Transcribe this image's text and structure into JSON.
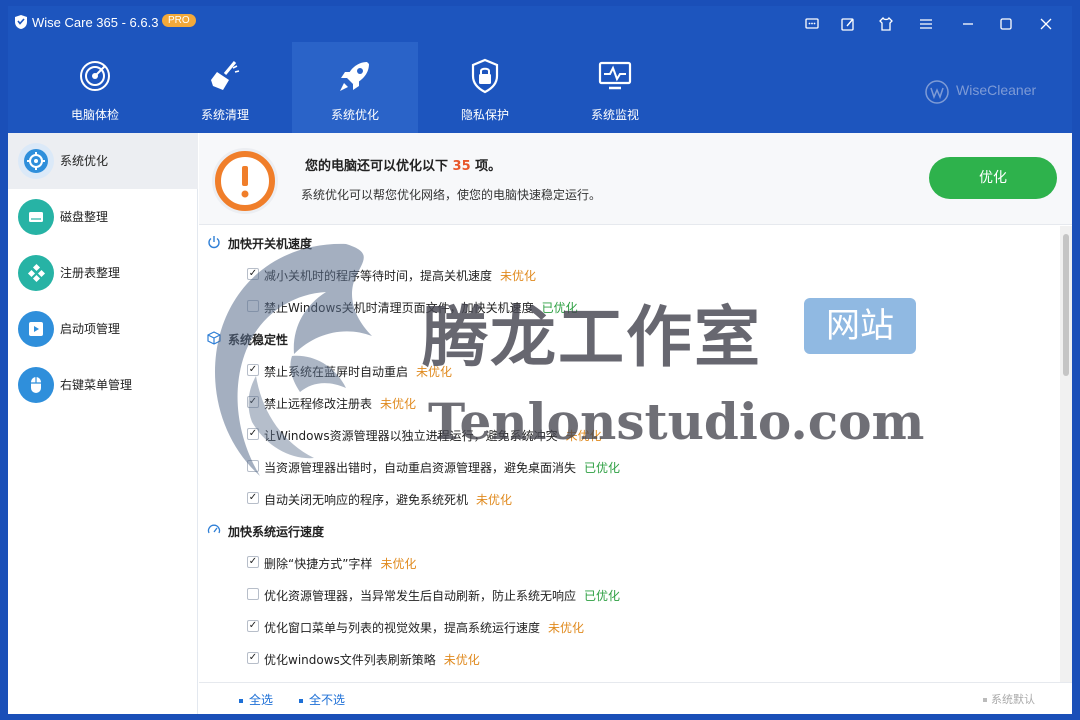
{
  "window": {
    "app_title": "Wise Care 365 - 6.6.3",
    "badge": "PRO",
    "toolbar_icons": [
      "chat-icon",
      "edit-icon",
      "tshirt-icon",
      "menu-icon",
      "minimize-icon",
      "maximize-icon",
      "close-icon"
    ]
  },
  "nav": {
    "items": [
      {
        "label": "电脑体检",
        "icon": "radar-icon"
      },
      {
        "label": "系统清理",
        "icon": "broom-icon"
      },
      {
        "label": "系统优化",
        "icon": "rocket-icon"
      },
      {
        "label": "隐私保护",
        "icon": "lock-icon"
      },
      {
        "label": "系统监视",
        "icon": "monitor-pulse-icon"
      }
    ],
    "active": "系统优化",
    "brand": "WiseCleaner"
  },
  "sidebar": {
    "items": [
      {
        "label": "系统优化",
        "icon": "gear-icon",
        "color": "#2f8fdb"
      },
      {
        "label": "磁盘整理",
        "icon": "disk-icon",
        "color": "#27b3a5"
      },
      {
        "label": "注册表整理",
        "icon": "registry-icon",
        "color": "#27b3a5"
      },
      {
        "label": "启动项管理",
        "icon": "play-icon",
        "color": "#2f8fdb"
      },
      {
        "label": "右键菜单管理",
        "icon": "mouse-icon",
        "color": "#2f8fdb"
      }
    ],
    "active": "系统优化"
  },
  "header": {
    "title_prefix": "您的电脑还可以优化以下",
    "count": "35",
    "title_suffix": "项。",
    "desc": "系统优化可以帮您优化网络，使您的电脑快速稳定运行。",
    "button": "优化"
  },
  "sections": [
    {
      "title": "加快开关机速度",
      "icon": "power-icon",
      "items": [
        {
          "text": "减小关机时的程序等待时间，提高关机速度",
          "checked": true,
          "status": "未优化"
        },
        {
          "text": "禁止Windows关机时清理页面文件，加快关机速度",
          "checked": false,
          "status": "已优化"
        }
      ]
    },
    {
      "title": "系统稳定性",
      "icon": "cube-icon",
      "items": [
        {
          "text": "禁止系统在蓝屏时自动重启",
          "checked": true,
          "status": "未优化"
        },
        {
          "text": "禁止远程修改注册表",
          "checked": true,
          "status": "未优化"
        },
        {
          "text": "让Windows资源管理器以独立进程运行，避免系统冲突",
          "checked": true,
          "status": "未优化"
        },
        {
          "text": "当资源管理器出错时，自动重启资源管理器，避免桌面消失",
          "checked": false,
          "status": "已优化"
        },
        {
          "text": "自动关闭无响应的程序，避免系统死机",
          "checked": true,
          "status": "未优化"
        }
      ]
    },
    {
      "title": "加快系统运行速度",
      "icon": "speedometer-icon",
      "items": [
        {
          "text": "删除“快捷方式”字样",
          "checked": true,
          "status": "未优化"
        },
        {
          "text": "优化资源管理器，当异常发生后自动刷新，防止系统无响应",
          "checked": false,
          "status": "已优化"
        },
        {
          "text": "优化窗口菜单与列表的视觉效果，提高系统运行速度",
          "checked": true,
          "status": "未优化"
        },
        {
          "text": "优化windows文件列表刷新策略",
          "checked": true,
          "status": "未优化"
        }
      ]
    }
  ],
  "footer": {
    "select_all": "全选",
    "select_none": "全不选",
    "system_default": "系统默认"
  },
  "watermark": {
    "cn_text": "腾龙工作室",
    "badge_text": "网站",
    "url_text": "Tenlonstudio.com"
  }
}
